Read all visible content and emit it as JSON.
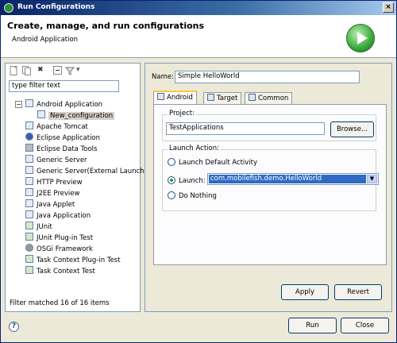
{
  "window": {
    "title": "Run Configurations",
    "close_glyph": "×"
  },
  "header": {
    "title": "Create, manage, and run configurations",
    "subtitle": "Android Application",
    "icon": "run-icon"
  },
  "toolbar": {
    "icons": [
      "new-launch-config-icon",
      "duplicate-icon",
      "delete-icon",
      "collapse-all-icon",
      "filter-icon",
      "dropdown-arrow-icon"
    ],
    "delete_glyph": "✖",
    "dropdown_glyph": "▾"
  },
  "filter": {
    "placeholder": "type filter text",
    "value": "type filter text"
  },
  "tree": {
    "items": [
      {
        "label": "Android Application",
        "icon": "android-icon",
        "expander": "−"
      },
      {
        "label": "New_configuration",
        "icon": "android-icon",
        "selected": true
      },
      {
        "label": "Apache Tomcat",
        "icon": "tomcat-icon"
      },
      {
        "label": "Eclipse Application",
        "icon": "eclipse-icon"
      },
      {
        "label": "Eclipse Data Tools",
        "icon": "database-icon"
      },
      {
        "label": "Generic Server",
        "icon": "server-icon"
      },
      {
        "label": "Generic Server(External Launch)",
        "icon": "server-icon"
      },
      {
        "label": "HTTP Preview",
        "icon": "server-icon"
      },
      {
        "label": "J2EE Preview",
        "icon": "server-icon"
      },
      {
        "label": "Java Applet",
        "icon": "applet-icon"
      },
      {
        "label": "Java Application",
        "icon": "java-app-icon"
      },
      {
        "label": "JUnit",
        "icon": "junit-icon"
      },
      {
        "label": "JUnit Plug-in Test",
        "icon": "junit-plugin-icon"
      },
      {
        "label": "OSGi Framework",
        "icon": "osgi-icon"
      },
      {
        "label": "Task Context Plug-in Test",
        "icon": "task-context-icon"
      },
      {
        "label": "Task Context Test",
        "icon": "task-context-icon"
      }
    ],
    "status": "Filter matched 16 of 16 items"
  },
  "config": {
    "name_label": "Name:",
    "name_value": "Simple HelloWorld",
    "tabs": [
      {
        "label": "Android",
        "icon": "android-tab-icon",
        "active": true
      },
      {
        "label": "Target",
        "icon": "target-tab-icon",
        "active": false
      },
      {
        "label": "Common",
        "icon": "common-tab-icon",
        "active": false
      }
    ],
    "project_group": "Project:",
    "project_value": "TestApplications",
    "browse_label": "Browse...",
    "launch_group": "Launch Action:",
    "radio_options": [
      {
        "label": "Launch Default Activity",
        "checked": false
      },
      {
        "label": "Launch:",
        "checked": true
      },
      {
        "label": "Do Nothing",
        "checked": false
      }
    ],
    "launch_activity": "com.mobilefish.demo.HelloWorld",
    "combo_arrow": "▼",
    "apply_label": "Apply",
    "revert_label": "Revert"
  },
  "footer": {
    "help_glyph": "?",
    "run_label": "Run",
    "close_label": "Close"
  }
}
